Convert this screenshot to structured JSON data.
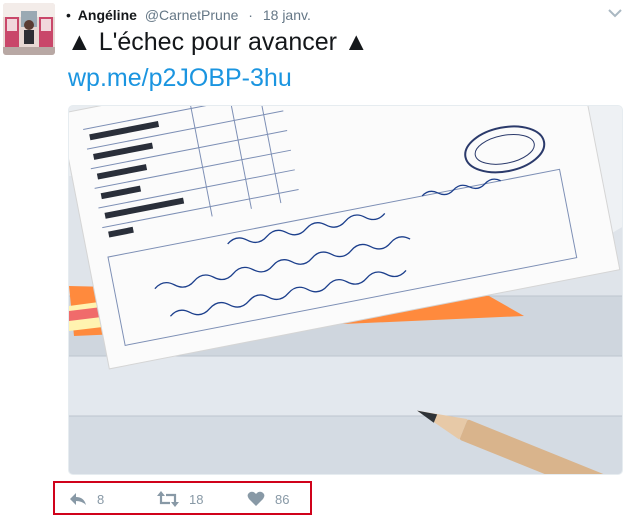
{
  "tweet": {
    "bullet": "•",
    "author_name": "Angéline",
    "author_handle": "@CarnetPrune",
    "separator": "·",
    "date": "18 janv.",
    "text": "▲ L'échec pour avancer ▲",
    "link": "wp.me/p2JOBP-3hu"
  },
  "actions": {
    "reply_count": "8",
    "retweet_count": "18",
    "like_count": "86"
  },
  "icons": {
    "menu": "chevron-down-icon",
    "reply": "reply-icon",
    "retweet": "retweet-icon",
    "like": "heart-icon"
  },
  "colors": {
    "link": "#1b95e0",
    "muted": "#8899a6",
    "highlight_border": "#d0021b"
  }
}
